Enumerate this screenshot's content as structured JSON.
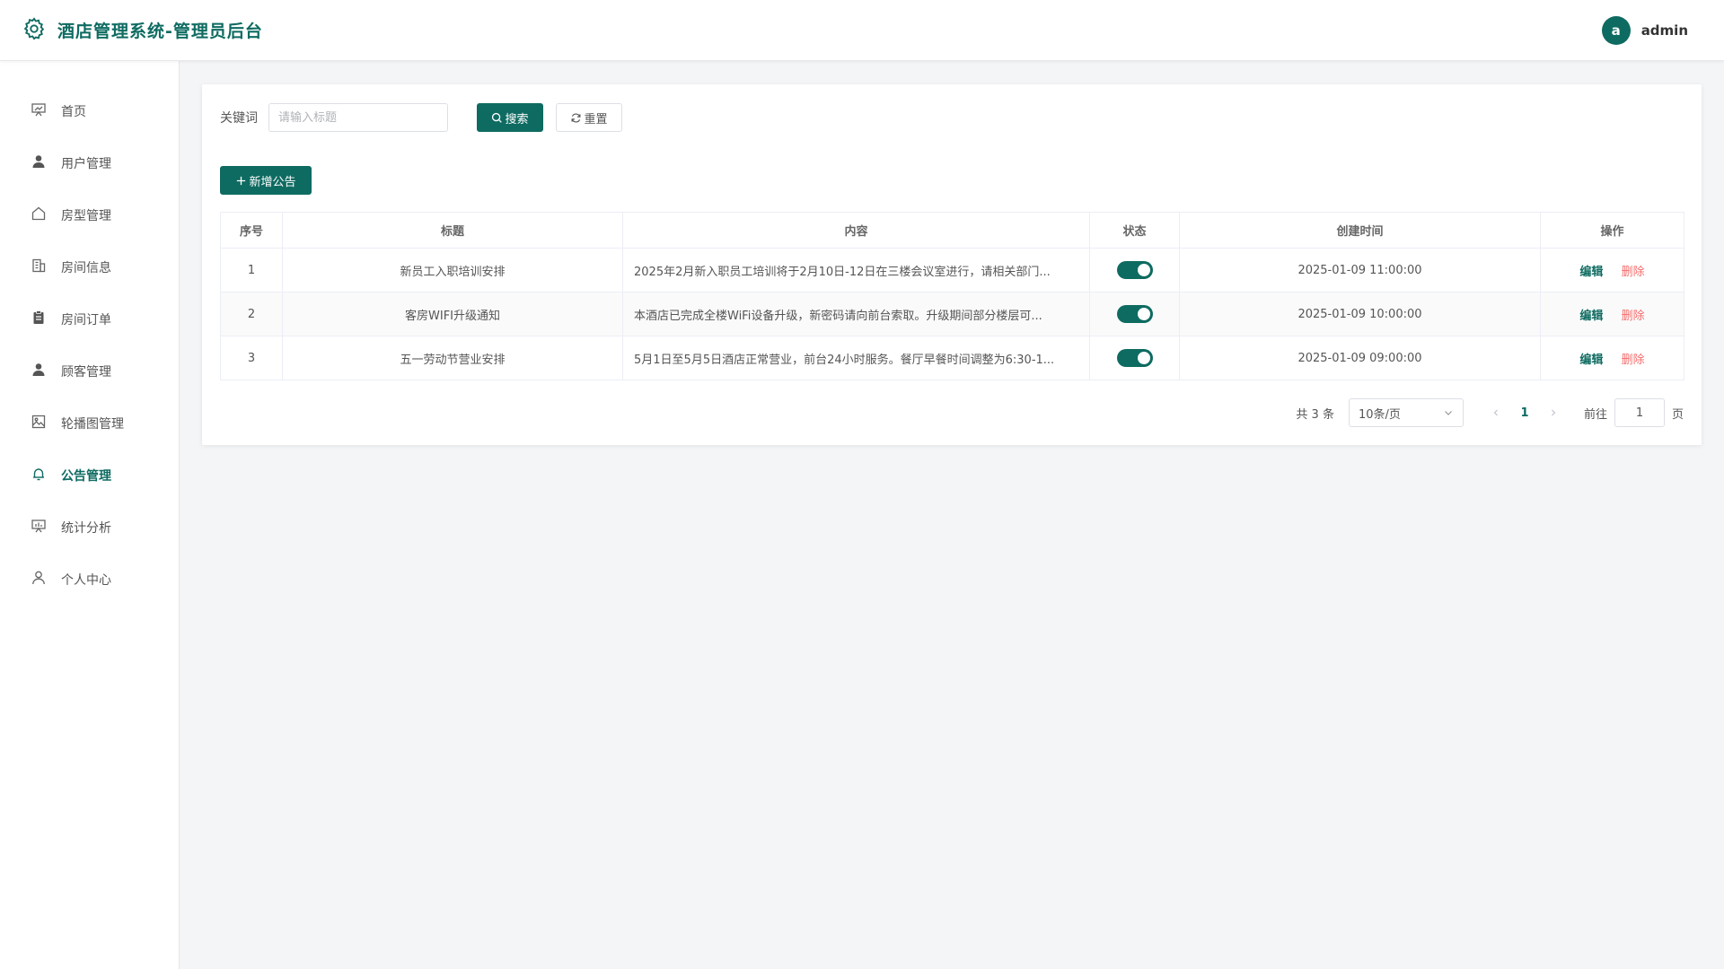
{
  "header": {
    "title": "酒店管理系统-管理员后台",
    "avatar_letter": "a",
    "username": "admin"
  },
  "sidebar": {
    "items": [
      {
        "label": "首页",
        "icon": "dashboard-icon"
      },
      {
        "label": "用户管理",
        "icon": "user-icon"
      },
      {
        "label": "房型管理",
        "icon": "house-icon"
      },
      {
        "label": "房间信息",
        "icon": "building-icon"
      },
      {
        "label": "房间订单",
        "icon": "clipboard-icon"
      },
      {
        "label": "顾客管理",
        "icon": "customer-icon"
      },
      {
        "label": "轮播图管理",
        "icon": "picture-icon"
      },
      {
        "label": "公告管理",
        "icon": "bell-icon",
        "active": true
      },
      {
        "label": "统计分析",
        "icon": "chart-icon"
      },
      {
        "label": "个人中心",
        "icon": "profile-icon"
      }
    ]
  },
  "search": {
    "label": "关键词",
    "placeholder": "请输入标题",
    "search_label": "搜索",
    "reset_label": "重置"
  },
  "toolbar": {
    "add_label": "新增公告"
  },
  "table": {
    "headers": [
      "序号",
      "标题",
      "内容",
      "状态",
      "创建时间",
      "操作"
    ],
    "rows": [
      {
        "no": "1",
        "title": "新员工入职培训安排",
        "content": "2025年2月新入职员工培训将于2月10日-12日在三楼会议室进行，请相关部门...",
        "status_on": true,
        "created": "2025-01-09 11:00:00"
      },
      {
        "no": "2",
        "title": "客房WIFI升级通知",
        "content": "本酒店已完成全楼WiFi设备升级，新密码请向前台索取。升级期间部分楼层可...",
        "status_on": true,
        "created": "2025-01-09 10:00:00"
      },
      {
        "no": "3",
        "title": "五一劳动节营业安排",
        "content": "5月1日至5月5日酒店正常营业，前台24小时服务。餐厅早餐时间调整为6:30-1...",
        "status_on": true,
        "created": "2025-01-09 09:00:00"
      }
    ],
    "edit_label": "编辑",
    "delete_label": "删除"
  },
  "pagination": {
    "total_text": "共 3 条",
    "page_size": "10条/页",
    "current_page": "1",
    "goto_label": "前往",
    "goto_value": "1",
    "page_suffix": "页"
  },
  "colors": {
    "primary": "#0e6b61",
    "danger": "#f56c6c"
  }
}
